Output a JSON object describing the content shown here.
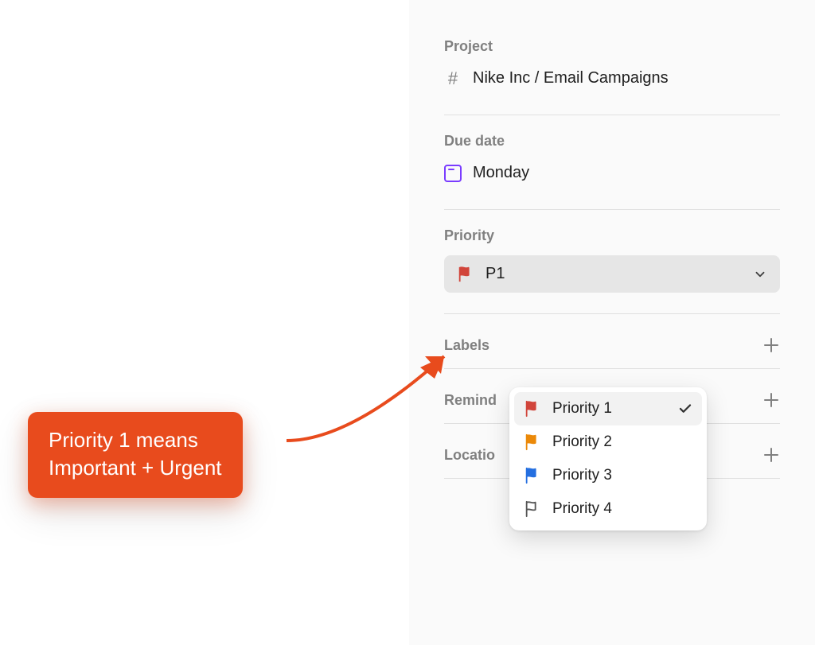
{
  "sections": {
    "project": {
      "label": "Project",
      "value": "Nike Inc / Email Campaigns"
    },
    "due_date": {
      "label": "Due date",
      "value": "Monday"
    },
    "priority": {
      "label": "Priority",
      "selected_short": "P1"
    },
    "labels": {
      "label": "Labels"
    },
    "reminders": {
      "label": "Remind"
    },
    "location": {
      "label": "Locatio"
    }
  },
  "priority_options": [
    {
      "label": "Priority 1",
      "color": "#d1453b",
      "selected": true
    },
    {
      "label": "Priority 2",
      "color": "#eb8909",
      "selected": false
    },
    {
      "label": "Priority 3",
      "color": "#246fe0",
      "selected": false
    },
    {
      "label": "Priority 4",
      "color": "none",
      "selected": false
    }
  ],
  "callout": {
    "text": "Priority 1 means\nImportant + Urgent",
    "bg_color": "#e84b1d"
  }
}
